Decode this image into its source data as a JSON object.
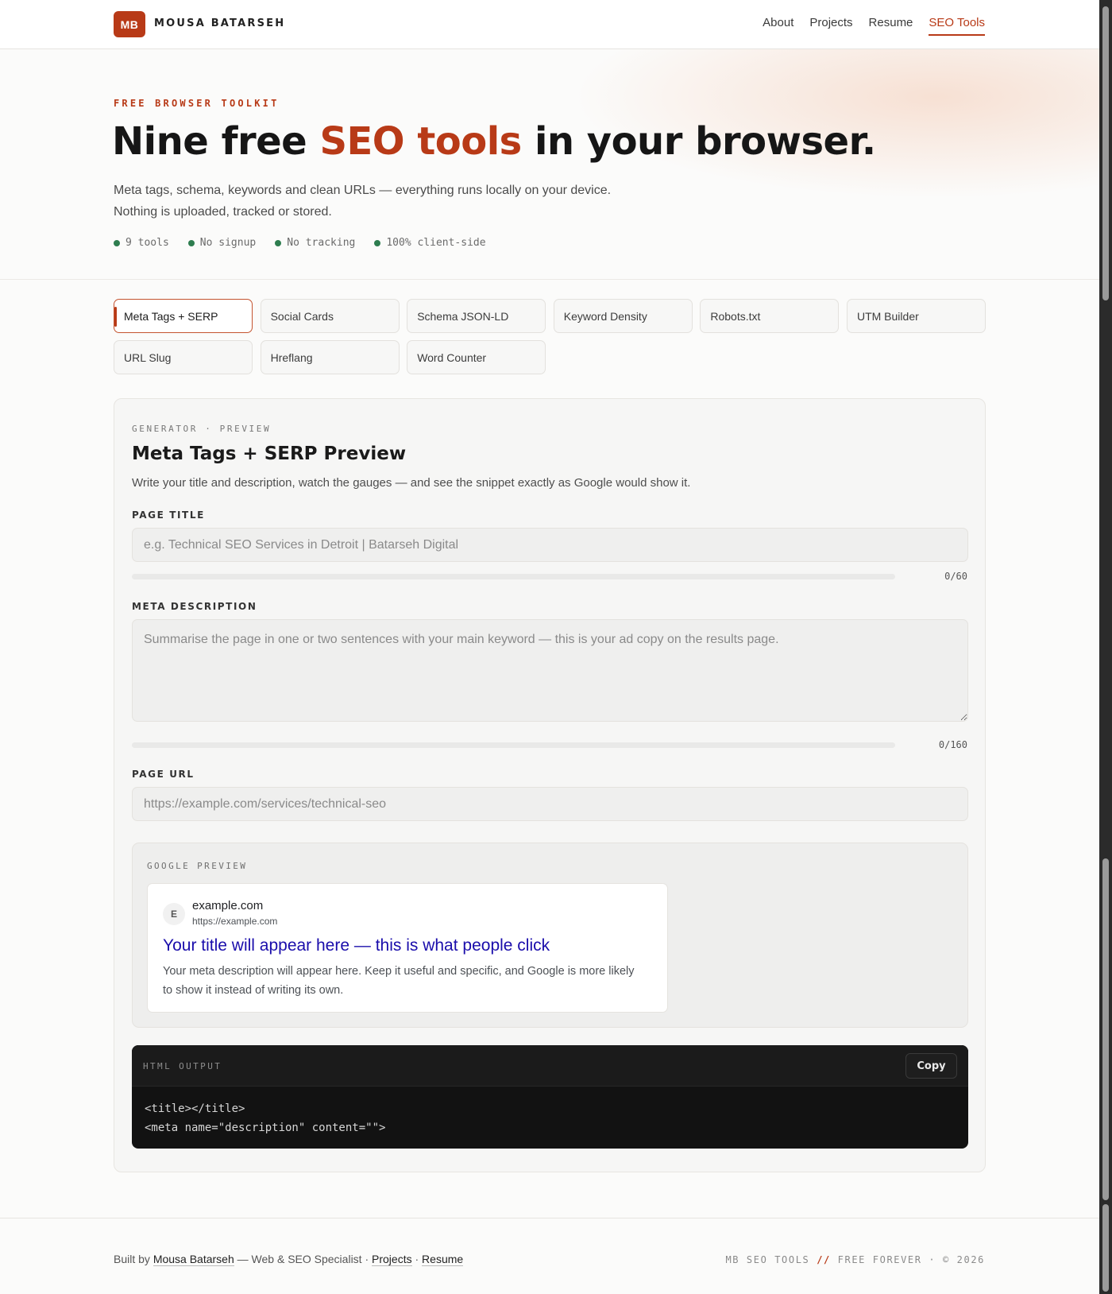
{
  "brand": {
    "initials": "MB",
    "name": "MOUSA BATARSEH"
  },
  "nav": [
    {
      "label": "About",
      "active": false
    },
    {
      "label": "Projects",
      "active": false
    },
    {
      "label": "Resume",
      "active": false
    },
    {
      "label": "SEO Tools",
      "active": true
    }
  ],
  "hero": {
    "eyebrow": "FREE BROWSER TOOLKIT",
    "title_before": "Nine free ",
    "title_accent": "SEO tools",
    "title_after": " in your browser.",
    "subtitle_line1": "Meta tags, schema, keywords and clean URLs — everything runs locally on your device.",
    "subtitle_line2": "Nothing is uploaded, tracked or stored.",
    "chips": [
      "9 tools",
      "No signup",
      "No tracking",
      "100% client-side"
    ]
  },
  "tabs": [
    {
      "label": "Meta Tags + SERP",
      "active": true
    },
    {
      "label": "Social Cards",
      "active": false
    },
    {
      "label": "Schema JSON-LD",
      "active": false
    },
    {
      "label": "Keyword Density",
      "active": false
    },
    {
      "label": "Robots.txt",
      "active": false
    },
    {
      "label": "UTM Builder",
      "active": false
    },
    {
      "label": "URL Slug",
      "active": false
    },
    {
      "label": "Hreflang",
      "active": false
    },
    {
      "label": "Word Counter",
      "active": false
    }
  ],
  "tool": {
    "eyebrow": "GENERATOR · PREVIEW",
    "title": "Meta Tags + SERP Preview",
    "description": "Write your title and description, watch the gauges — and see the snippet exactly as Google would show it.",
    "title_field": {
      "label": "PAGE TITLE",
      "value": "",
      "placeholder": "e.g. Technical SEO Services in Detroit | Batarseh Digital",
      "counter": "0/60",
      "fill": 0
    },
    "description_field": {
      "label": "META DESCRIPTION",
      "value": "",
      "placeholder": "Summarise the page in one or two sentences with your main keyword — this is your ad copy on the results page.",
      "counter": "0/160",
      "fill": 0
    },
    "url_field": {
      "label": "PAGE URL",
      "value": "",
      "placeholder": "https://example.com/services/technical-seo"
    },
    "preview": {
      "label": "GOOGLE PREVIEW",
      "favicon": "E",
      "site": "example.com",
      "url": "https://example.com",
      "title": "Your title will appear here — this is what people click",
      "description": "Your meta description will appear here. Keep it useful and specific, and Google is more likely to show it instead of writing its own."
    },
    "output": {
      "label": "HTML OUTPUT",
      "copy_label": "Copy",
      "code": "<title></title>\n<meta name=\"description\" content=\"\">"
    }
  },
  "footer": {
    "built_by": "Built by ",
    "author": "Mousa Batarseh",
    "role": " — Web & SEO Specialist · ",
    "projects": "Projects",
    "sep": " · ",
    "resume": "Resume",
    "right_prefix": "MB SEO TOOLS ",
    "right_slash": "//",
    "right_suffix": " FREE FOREVER · © 2026"
  },
  "colors": {
    "accent": "#b83a17",
    "ok": "#2e7d4f",
    "serp_link": "#1a0dab"
  }
}
